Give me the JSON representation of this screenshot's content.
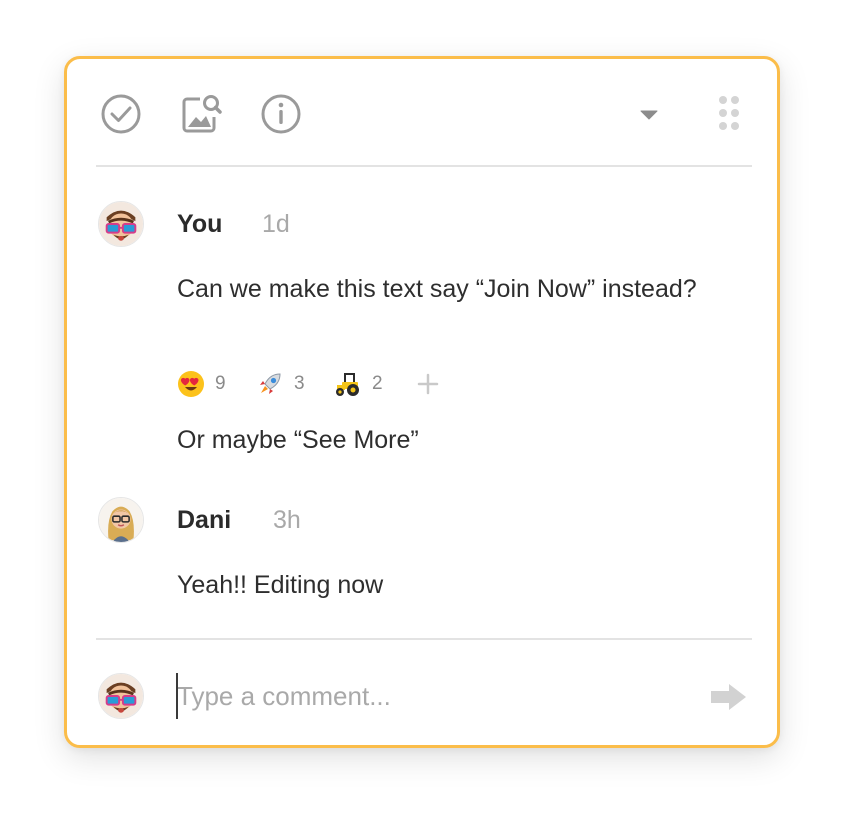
{
  "toolbar": {
    "icons": [
      "resolve-check-icon",
      "image-search-icon",
      "info-icon",
      "dropdown-caret-icon",
      "drag-handle-icon"
    ]
  },
  "thread": {
    "comments": [
      {
        "author": "You",
        "time": "1d",
        "messages": [
          "Can we make this text say “Join Now” instead?",
          "Or maybe “See More”"
        ],
        "reactions": [
          {
            "emoji": "heart-eyes-emoji",
            "count": "9"
          },
          {
            "emoji": "rocket-emoji",
            "count": "3"
          },
          {
            "emoji": "tractor-emoji",
            "count": "2"
          }
        ]
      },
      {
        "author": "Dani",
        "time": "3h",
        "messages": [
          "Yeah!! Editing now"
        ]
      }
    ]
  },
  "composer": {
    "placeholder": "Type a comment...",
    "value": ""
  },
  "colors": {
    "border_accent": "#fbbd4a",
    "icon_gray": "#9a9a9a",
    "text": "#2e2e2e",
    "muted": "#a9a9a9"
  }
}
